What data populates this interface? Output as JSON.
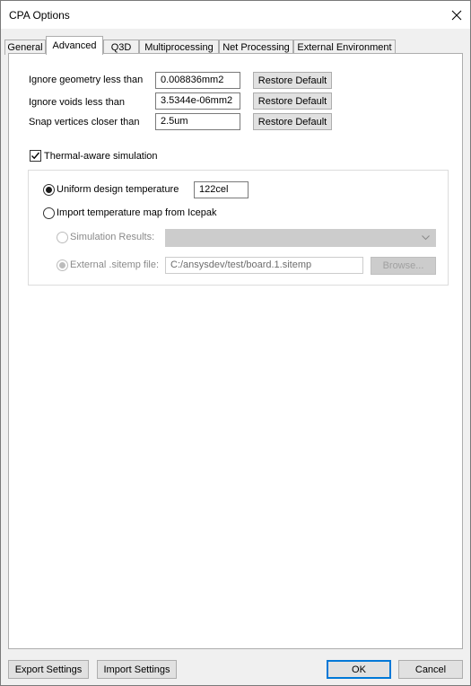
{
  "window": {
    "title": "CPA Options"
  },
  "tabs": [
    {
      "label": "General",
      "active": false
    },
    {
      "label": "Advanced",
      "active": true
    },
    {
      "label": "Q3D",
      "active": false
    },
    {
      "label": "Multiprocessing",
      "active": false
    },
    {
      "label": "Net Processing",
      "active": false
    },
    {
      "label": "External Environment",
      "active": false
    }
  ],
  "advanced": {
    "rows": [
      {
        "label": "Ignore geometry less than",
        "value": "0.008836mm2",
        "button": "Restore Default"
      },
      {
        "label": "Ignore voids less than",
        "value": "3.5344e-06mm2",
        "button": "Restore Default"
      },
      {
        "label": "Snap vertices closer than",
        "value": "2.5um",
        "button": "Restore Default"
      }
    ],
    "thermal": {
      "checkbox_label": "Thermal-aware simulation",
      "checked": true,
      "uniform_label": "Uniform design temperature",
      "uniform_value": "122cel",
      "import_label": "Import temperature map from Icepak",
      "sim_results_label": "Simulation Results:",
      "sim_results_value": "",
      "external_label": "External .sitemp file:",
      "external_value": "C:/ansysdev/test/board.1.sitemp",
      "browse_label": "Browse..."
    }
  },
  "footer": {
    "export_label": "Export Settings",
    "import_label": "Import Settings",
    "ok_label": "OK",
    "cancel_label": "Cancel"
  },
  "colors": {
    "accent": "#0078d7",
    "panel": "#ffffff",
    "chrome": "#f0f0f0"
  }
}
